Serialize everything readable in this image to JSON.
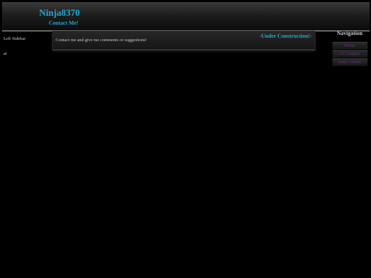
{
  "header": {
    "title": "Ninja8370",
    "subtitle": "Contact Me!"
  },
  "left_sidebar": {
    "title": "Left Sidebar",
    "text": "af"
  },
  "main": {
    "status": "-Under Construction!-",
    "body": "Contact me and give me comments or suggestions!"
  },
  "navigation": {
    "title": "Navigation",
    "items": [
      {
        "label": "Home"
      },
      {
        "label": "GG Empire"
      },
      {
        "label": "Saido Online"
      }
    ]
  },
  "colors": {
    "accent": "#2aa6cf",
    "link": "#6e2a8a",
    "background": "#000000"
  }
}
